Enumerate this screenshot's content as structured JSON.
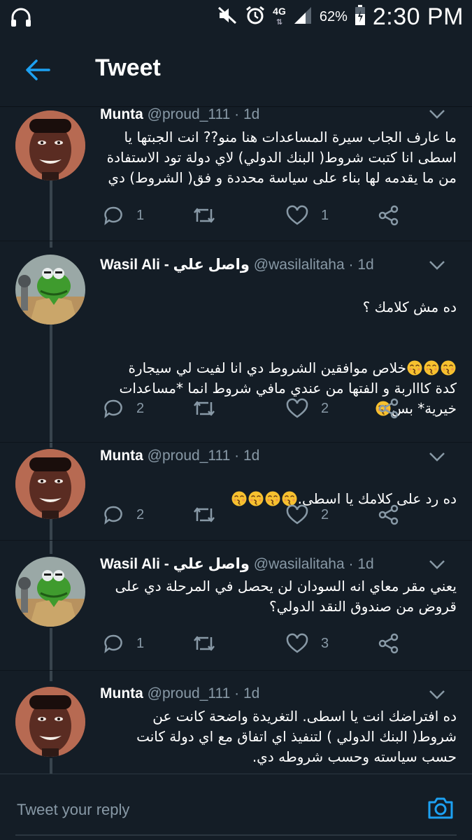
{
  "status_bar": {
    "network": "4G",
    "battery": "62%",
    "time": "2:30 PM"
  },
  "header": {
    "title": "Tweet"
  },
  "tweets": [
    {
      "name": "Munta",
      "handle": "@proud_111",
      "age": "1d",
      "text": "ما عارف الجاب سيرة المساعدات هنا منو?? انت الجبتها يا\nاسطى انا كتبت شروط( البنك الدولي) لاي دولة تود الاستفادة\nمن ما يقدمه لها بناء على سياسة محددة و فق(  الشروط) دي",
      "replies": "1",
      "likes": "1"
    },
    {
      "name": "Wasil Ali - واصل علي",
      "handle": "@wasilalitaha",
      "age": "1d",
      "text_line1": "ده مش كلامك ؟",
      "text_body": "خلاص موافقين الشروط دي انا لفيت لي سيجارة\nكدة كاااربة و الفتها من عندي مافي شروط انما *مساعدات\nخيرية* بس",
      "replies": "2",
      "likes": "2"
    },
    {
      "name": "Munta",
      "handle": "@proud_111",
      "age": "1d",
      "text": "ده رد على كلامك يا اسطى.",
      "replies": "2",
      "likes": "2"
    },
    {
      "name": "Wasil Ali - واصل علي",
      "handle": "@wasilalitaha",
      "age": "1d",
      "text": "يعني مقر معاي انه السودان لن يحصل في المرحلة دي على\nقروض من صندوق النقد الدولي؟",
      "replies": "1",
      "likes": "3"
    },
    {
      "name": "Munta",
      "handle": "@proud_111",
      "age": "1d",
      "text": "ده افتراضك انت يا اسطى. التغريدة واضحة كانت عن\nشروط( البنك الدولي ) لتنفيذ اي اتفاق مع اي دولة كانت\nحسب سياسته وحسب شروطه دي."
    }
  ],
  "reply_bar": {
    "placeholder": "Tweet your reply"
  },
  "colors": {
    "background": "#141d26",
    "secondary_text": "#8899a6",
    "accent": "#1da1f2",
    "thread_line": "#38444d"
  },
  "icons": [
    "headphones-icon",
    "mute-icon",
    "alarm-icon",
    "signal-icon",
    "battery-icon",
    "back-arrow-icon",
    "chevron-down-icon",
    "reply-icon",
    "retweet-icon",
    "like-icon",
    "share-icon",
    "camera-icon",
    "kissing-face-emoji"
  ]
}
